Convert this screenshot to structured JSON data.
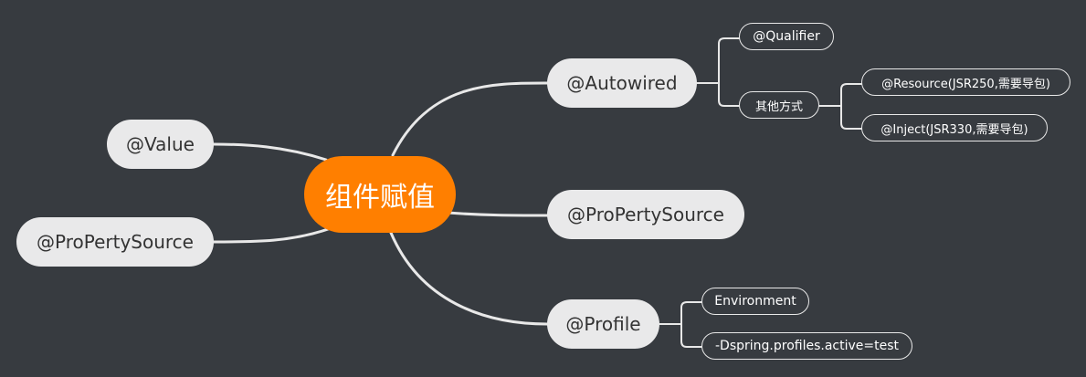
{
  "central": {
    "label": "组件赋值",
    "color": "#ff7f00"
  },
  "left_branches": [
    {
      "label": "@Value"
    },
    {
      "label": "@ProPertySource"
    }
  ],
  "right_branches": [
    {
      "label": "@Autowired",
      "children": [
        {
          "label": "@Qualifier"
        },
        {
          "label": "其他方式",
          "children": [
            {
              "label": "@Resource(JSR250,需要导包)"
            },
            {
              "label": "@Inject(JSR330,需要导包)"
            }
          ]
        }
      ]
    },
    {
      "label": "@ProPertySource"
    },
    {
      "label": "@Profile",
      "children": [
        {
          "label": "Environment"
        },
        {
          "label": "-Dspring.profiles.active=test"
        }
      ]
    }
  ],
  "colors": {
    "background": "#373b40",
    "connector": "#e8e8e8",
    "main_node": "#e9e9ea",
    "main_text": "#333333"
  }
}
